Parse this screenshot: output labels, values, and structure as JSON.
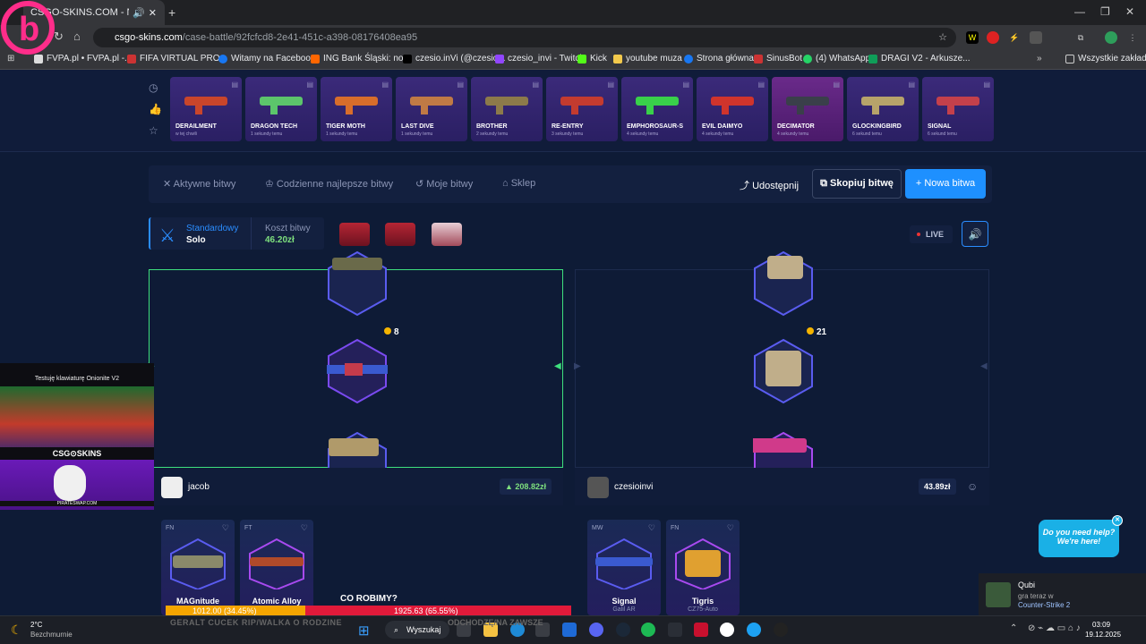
{
  "browser": {
    "tab_title": "CSGO-SKINS.COM - Najlep",
    "url_domain": "csgo-skins.com",
    "url_path": "/case-battle/92fcfcd8-2e41-451c-a398-08176408ea95",
    "bookmarks": [
      "FVPA.pl • FVPA.pl -...",
      "FIFA VIRTUAL PRO...",
      "Witamy na Faceboo...",
      "ING Bank Śląski: no...",
      "czesio.inVi (@czesio...",
      "czesio_invi - Twitch",
      "Kick",
      "youtube muza",
      "Strona główna",
      "SinusBot",
      "(4) WhatsApp",
      "DRAGI V2 - Arkusze..."
    ],
    "all_bookmarks": "Wszystkie zakładki"
  },
  "live_drops": [
    {
      "name": "DERAILMENT",
      "time": "w tej chwili",
      "color": "#c9452b"
    },
    {
      "name": "DRAGON TECH",
      "time": "1 sekundy temu",
      "color": "#5cc56b"
    },
    {
      "name": "TIGER MOTH",
      "time": "1 sekundy temu",
      "color": "#d86d2b"
    },
    {
      "name": "LAST DIVE",
      "time": "1 sekundy temu",
      "color": "#c07a45"
    },
    {
      "name": "BROTHER",
      "time": "2 sekundy temu",
      "color": "#8c7a4a"
    },
    {
      "name": "RE-ENTRY",
      "time": "3 sekundy temu",
      "color": "#c43b2f"
    },
    {
      "name": "EMPHOROSAUR-S",
      "time": "4 sekundy temu",
      "color": "#39d04a"
    },
    {
      "name": "EVIL DAIMYO",
      "time": "4 sekundy temu",
      "color": "#d0342c"
    },
    {
      "name": "DECIMATOR",
      "time": "4 sekundy temu",
      "color": "#3a3f4a"
    },
    {
      "name": "GLOCKINGBIRD",
      "time": "6 sekund temu",
      "color": "#b7a36a"
    },
    {
      "name": "SIGNAL",
      "time": "6 sekund temu",
      "color": "#c4404b"
    }
  ],
  "nav": {
    "active_battles": "Aktywne bitwy",
    "daily_best": "Codzienne najlepsze bitwy",
    "my_battles": "Moje bitwy",
    "shop": "Sklep",
    "share": "Udostępnij",
    "copy_battle": "Skopiuj bitwę",
    "new_battle": "Nowa bitwa"
  },
  "battle": {
    "mode_label": "Standardowy",
    "mode_value": "Solo",
    "cost_label": "Koszt bitwy",
    "cost_value": "46.20zł",
    "live": "LIVE"
  },
  "players": [
    {
      "name": "jacob",
      "total": "208.82zł",
      "coins": "8",
      "items": [
        {
          "cond": "FN",
          "name": "MAGnitude",
          "sub": ""
        },
        {
          "cond": "FT",
          "name": "Atomic Alloy",
          "sub": ""
        }
      ]
    },
    {
      "name": "czesioinvi",
      "total": "43.89zł",
      "coins": "21",
      "items": [
        {
          "cond": "MW",
          "name": "Signal",
          "sub": "Galil AR"
        },
        {
          "cond": "FN",
          "name": "Tigris",
          "sub": "CZ75-Auto"
        }
      ]
    }
  ],
  "stream": {
    "title": "Testuję klawiaturę Onionite V2",
    "brand": "CSG⊙SKINS",
    "banner": "PIRATESWAP.COM",
    "question": "CO ROBIMY?",
    "bar_left": "1012.00 (34.45%)",
    "bar_right": "1925.63 (65.55%)",
    "bar_left_fraction": 0.3445,
    "left_caption": "GERALT CUCEK RIP/WALKA O RODZINE",
    "right_caption": "ODCHODZĘ/NA ZAWSZE"
  },
  "chat": {
    "line1": "Do you need help?",
    "line2": "We're here!"
  },
  "notification": {
    "user": "Qubi",
    "line": "gra teraz w",
    "game": "Counter-Strike 2"
  },
  "taskbar": {
    "temp": "2°C",
    "weather": "Bezchmurnie",
    "search": "Wyszukaj",
    "time": "03:09",
    "date": "19.12.2025"
  }
}
